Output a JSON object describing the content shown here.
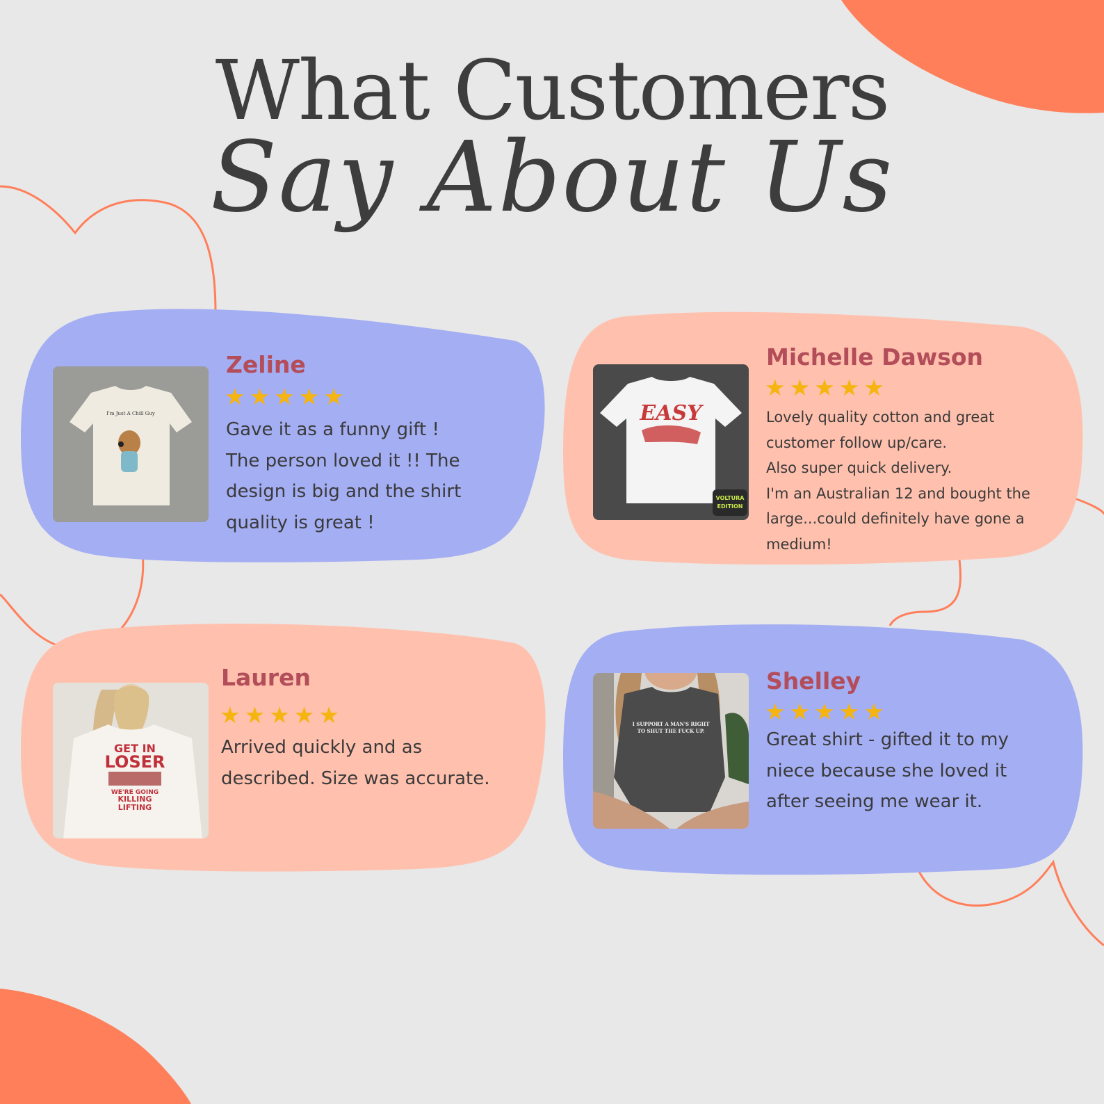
{
  "page": {
    "title_line1": "What Customers",
    "title_line2": "Say About Us",
    "colors": {
      "background": "#e8e8e8",
      "accent_orange": "#ff7f5a",
      "blob_purple": "#a4aef3",
      "blob_peach": "#ffc1ae",
      "name_color": "#b34d5a",
      "star_color": "#f5b40f",
      "text_color": "#3a3a3a"
    }
  },
  "reviews": [
    {
      "name": "Zeline",
      "rating": 5,
      "text": "Gave it as a funny gift !\nThe person loved it !! The\ndesign is big and the shirt\nquality is great !",
      "photo_text": "I'm Just A Chill Guy",
      "photo_icon": "beige-tshirt-with-dog-graphic"
    },
    {
      "name": "Michelle Dawson",
      "rating": 5,
      "text": "Lovely quality cotton and great\ncustomer follow up/care.\nAlso super quick delivery.\nI'm an Australian 12 and bought the\nlarge...could definitely have gone a\nmedium!",
      "photo_text": "EASY",
      "photo_logo": "VOLTURA\nEDITION",
      "photo_icon": "white-tshirt-with-tiger-graphic"
    },
    {
      "name": "Lauren",
      "rating": 5,
      "text": "Arrived quickly and as\ndescribed. Size was accurate.",
      "photo_text": "GET IN\nLOSER",
      "photo_subtext": "WE'RE GOING\nKILLING\nLIFTING",
      "photo_icon": "woman-in-white-tshirt"
    },
    {
      "name": "Shelley",
      "rating": 5,
      "text": "Great shirt - gifted it to my\nniece because she loved it\nafter seeing me wear it.",
      "photo_text": "I SUPPORT A MAN'S RIGHT\nTO SHUT THE FUCK UP.",
      "photo_icon": "woman-in-grey-tshirt"
    }
  ]
}
